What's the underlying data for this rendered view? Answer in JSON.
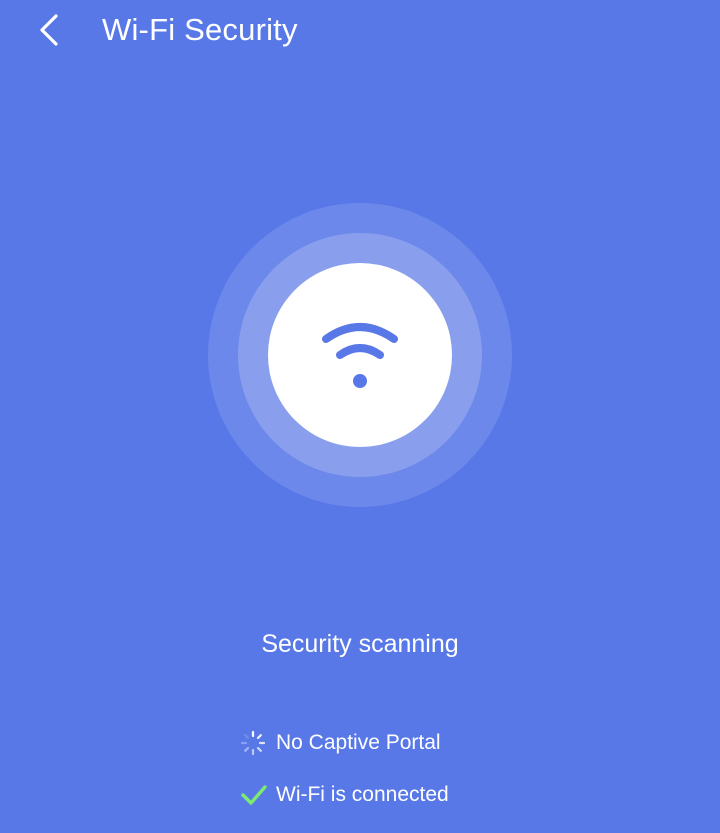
{
  "header": {
    "title": "Wi-Fi Security",
    "back_icon": "chevron-left-icon"
  },
  "scan": {
    "icon": "wifi-icon",
    "status": "Security scanning"
  },
  "checks": [
    {
      "label": "No Captive Portal",
      "state": "loading",
      "icon": "spinner-icon"
    },
    {
      "label": "Wi-Fi is connected",
      "state": "done",
      "icon": "check-icon"
    }
  ],
  "colors": {
    "background": "#5878E8",
    "accent": "#5878E8",
    "check": "#7CEB6E",
    "text": "#FFFFFF"
  }
}
